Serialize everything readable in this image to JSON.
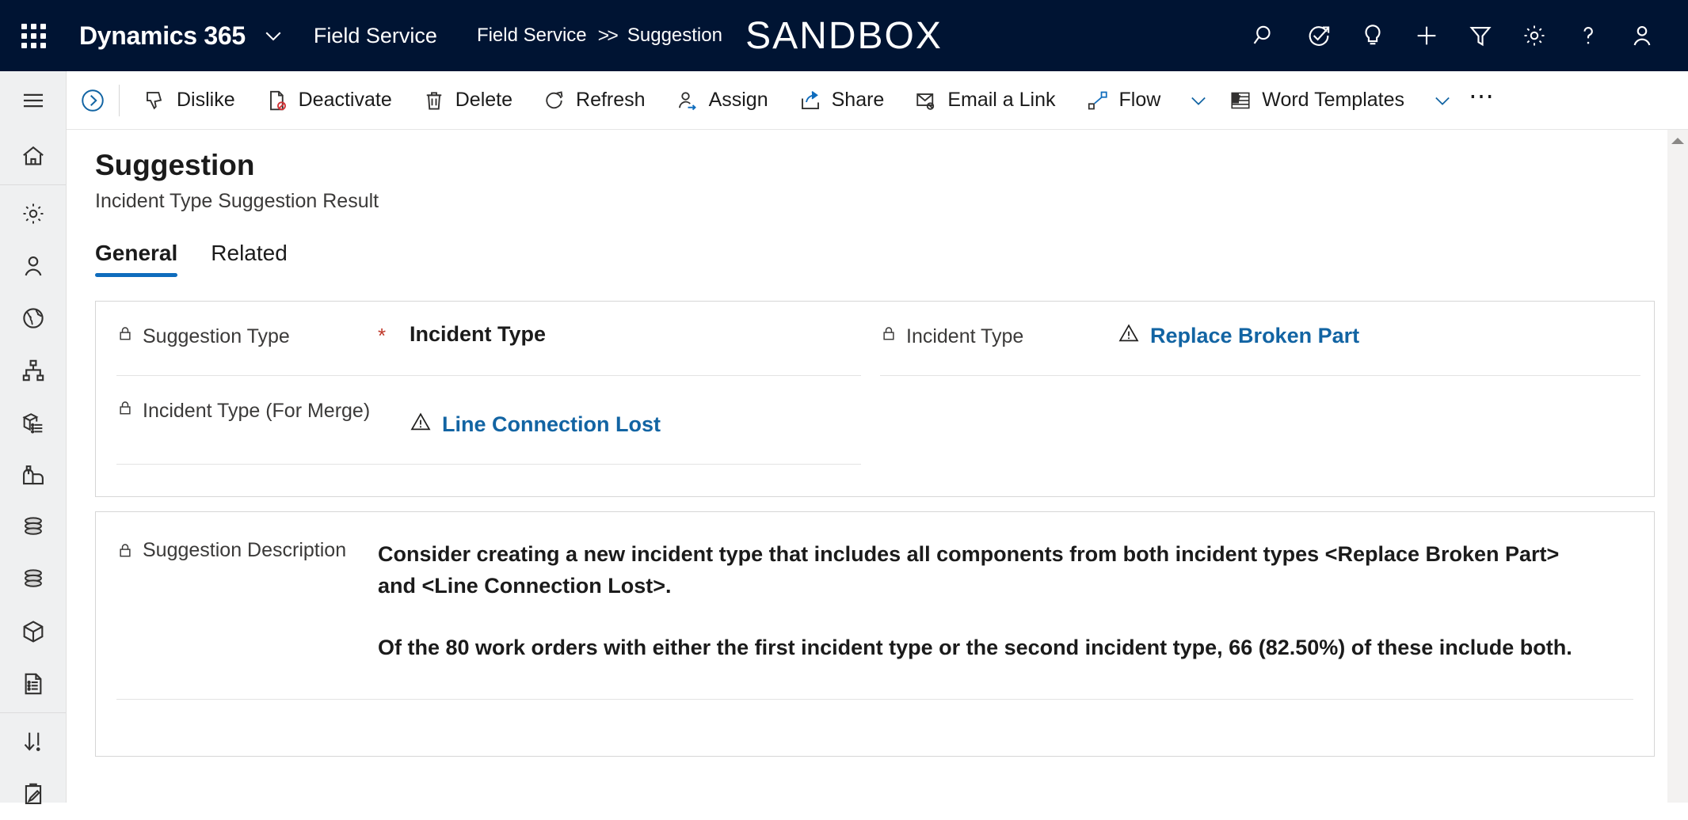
{
  "topnav": {
    "waffle_icon": "app-launcher-icon",
    "brand": "Dynamics 365",
    "brand_chevron_icon": "chevron-down-icon",
    "app_name": "Field Service",
    "breadcrumb": {
      "root": "Field Service",
      "separator": ">>",
      "current": "Suggestion"
    },
    "environment_banner": "SANDBOX",
    "icons": [
      {
        "name": "search-icon",
        "title": "Search"
      },
      {
        "name": "assistant-icon",
        "title": "Assistant"
      },
      {
        "name": "lightbulb-icon",
        "title": "Insights"
      },
      {
        "name": "plus-icon",
        "title": "Quick create"
      },
      {
        "name": "filter-icon",
        "title": "Filter"
      },
      {
        "name": "gear-icon",
        "title": "Settings"
      },
      {
        "name": "question-icon",
        "title": "Help"
      },
      {
        "name": "person-icon",
        "title": "Account manager"
      }
    ]
  },
  "rail": {
    "items": [
      {
        "name": "hamburger-icon",
        "title": "Expand navigation"
      },
      {
        "name": "home-icon",
        "title": "Home"
      },
      {
        "name": "gear-icon",
        "title": "Settings"
      },
      {
        "name": "person-icon",
        "title": "Accounts"
      },
      {
        "name": "globe-icon",
        "title": "Territories"
      },
      {
        "name": "hierarchy-icon",
        "title": "Organization"
      },
      {
        "name": "box-list-icon",
        "title": "Products"
      },
      {
        "name": "mailbox-icon",
        "title": "Queues"
      },
      {
        "name": "database-icon",
        "title": "Data 1"
      },
      {
        "name": "database-icon",
        "title": "Data 2"
      },
      {
        "name": "cube-icon",
        "title": "Assets"
      },
      {
        "name": "document-list-icon",
        "title": "Reports"
      },
      {
        "name": "import-icon",
        "title": "Imports"
      },
      {
        "name": "clipboard-pencil-icon",
        "title": "Notes"
      }
    ]
  },
  "commandbar": {
    "expand_icon": "chevron-right-circle-icon",
    "buttons": [
      {
        "label": "Dislike",
        "icon": "thumbs-down-icon"
      },
      {
        "label": "Deactivate",
        "icon": "deactivate-icon"
      },
      {
        "label": "Delete",
        "icon": "trash-icon"
      },
      {
        "label": "Refresh",
        "icon": "refresh-icon"
      },
      {
        "label": "Assign",
        "icon": "assign-person-icon"
      },
      {
        "label": "Share",
        "icon": "share-icon"
      },
      {
        "label": "Email a Link",
        "icon": "email-link-icon"
      },
      {
        "label": "Flow",
        "icon": "flow-icon",
        "chevron": true
      },
      {
        "label": "Word Templates",
        "icon": "word-template-icon",
        "chevron": true
      }
    ],
    "overflow_label": "⋯",
    "overflow_name": "more-commands-button"
  },
  "header": {
    "title": "Suggestion",
    "subtitle": "Incident Type Suggestion Result"
  },
  "tabs": [
    {
      "label": "General",
      "active": true
    },
    {
      "label": "Related",
      "active": false
    }
  ],
  "form": {
    "left_column": [
      {
        "label": "Suggestion Type",
        "required_marker": "*",
        "value": "Incident Type",
        "type": "text",
        "locked": true
      },
      {
        "label": "Incident Type (For Merge)",
        "value": "Line Connection Lost",
        "type": "link",
        "warn_icon": "warning-triangle-icon",
        "locked": true
      }
    ],
    "right_column": [
      {
        "label": "Incident Type",
        "value": "Replace Broken Part",
        "type": "link",
        "warn_icon": "warning-triangle-icon",
        "locked": true
      }
    ],
    "description": {
      "label": "Suggestion Description",
      "paragraphs": [
        "Consider creating a new incident type that includes all components from both incident types <Replace Broken Part> and <Line Connection Lost>.",
        "Of the 80 work orders with either the first incident type or the second incident type, 66 (82.50%) of these include both."
      ]
    }
  },
  "scrollbar": {
    "up_icon": "scroll-up-arrow-icon"
  },
  "colors": {
    "nav_background": "#001433",
    "accent_blue": "#0f6cbd",
    "link_blue": "#1264a3",
    "required_red": "#c0392b",
    "rail_background": "#eff0f1"
  }
}
